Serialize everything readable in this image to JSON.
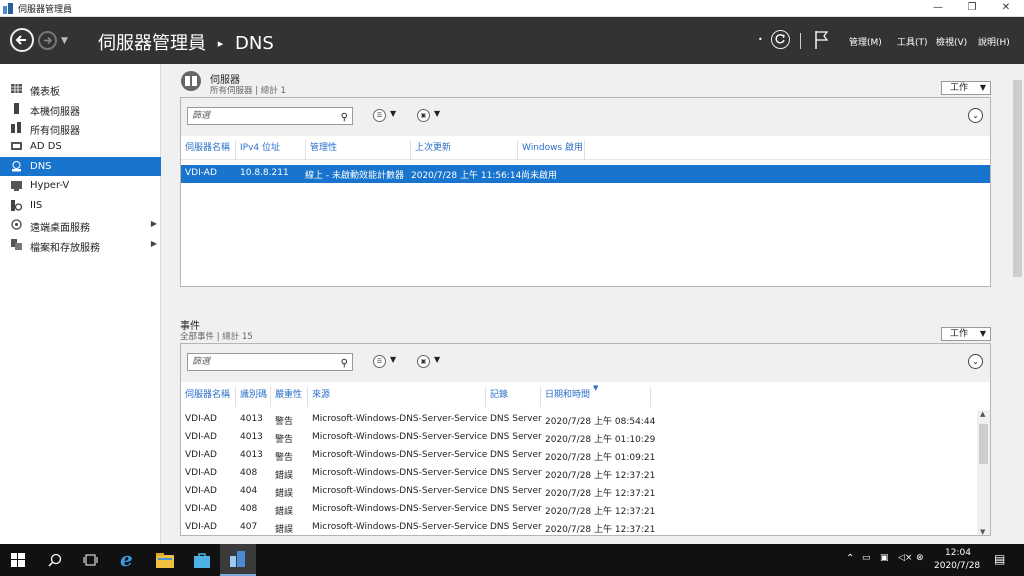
{
  "window": {
    "title": "伺服器管理員"
  },
  "header": {
    "crumb_root": "伺服器管理員",
    "crumb_current": "DNS",
    "menus": [
      "管理(M)",
      "工具(T)",
      "檢視(V)",
      "說明(H)"
    ]
  },
  "sidebar": {
    "items": [
      {
        "label": "儀表板"
      },
      {
        "label": "本機伺服器"
      },
      {
        "label": "所有伺服器"
      },
      {
        "label": "AD DS"
      },
      {
        "label": "DNS"
      },
      {
        "label": "Hyper-V"
      },
      {
        "label": "IIS"
      },
      {
        "label": "遠端桌面服務"
      },
      {
        "label": "檔案和存放服務"
      }
    ]
  },
  "servers": {
    "title": "伺服器",
    "subtitle": "所有伺服器 | 總計 1",
    "tasks_label": "工作",
    "filter_placeholder": "篩選",
    "columns": [
      "伺服器名稱",
      "IPv4 位址",
      "管理性",
      "上次更新",
      "Windows 啟用"
    ],
    "rows": [
      {
        "name": "VDI-AD",
        "ipv4": "10.8.8.211",
        "manageability": "線上 - 未啟動效能計數器",
        "last_update": "2020/7/28 上午 11:56:14",
        "activation": "尚未啟用"
      }
    ]
  },
  "events": {
    "title": "事件",
    "subtitle": "全部事件 | 總計 15",
    "tasks_label": "工作",
    "filter_placeholder": "篩選",
    "columns": [
      "伺服器名稱",
      "識別碼",
      "嚴重性",
      "來源",
      "記錄",
      "日期和時間"
    ],
    "rows": [
      {
        "server": "VDI-AD",
        "id": "4013",
        "severity": "警告",
        "source": "Microsoft-Windows-DNS-Server-Service",
        "log": "DNS Server",
        "datetime": "2020/7/28 上午 08:54:44"
      },
      {
        "server": "VDI-AD",
        "id": "4013",
        "severity": "警告",
        "source": "Microsoft-Windows-DNS-Server-Service",
        "log": "DNS Server",
        "datetime": "2020/7/28 上午 01:10:29"
      },
      {
        "server": "VDI-AD",
        "id": "4013",
        "severity": "警告",
        "source": "Microsoft-Windows-DNS-Server-Service",
        "log": "DNS Server",
        "datetime": "2020/7/28 上午 01:09:21"
      },
      {
        "server": "VDI-AD",
        "id": "408",
        "severity": "錯誤",
        "source": "Microsoft-Windows-DNS-Server-Service",
        "log": "DNS Server",
        "datetime": "2020/7/28 上午 12:37:21"
      },
      {
        "server": "VDI-AD",
        "id": "404",
        "severity": "錯誤",
        "source": "Microsoft-Windows-DNS-Server-Service",
        "log": "DNS Server",
        "datetime": "2020/7/28 上午 12:37:21"
      },
      {
        "server": "VDI-AD",
        "id": "408",
        "severity": "錯誤",
        "source": "Microsoft-Windows-DNS-Server-Service",
        "log": "DNS Server",
        "datetime": "2020/7/28 上午 12:37:21"
      },
      {
        "server": "VDI-AD",
        "id": "407",
        "severity": "錯誤",
        "source": "Microsoft-Windows-DNS-Server-Service",
        "log": "DNS Server",
        "datetime": "2020/7/28 上午 12:37:21"
      }
    ]
  },
  "taskbar": {
    "time": "12:04",
    "date": "2020/7/28"
  },
  "colors": {
    "header_bg": "#333333",
    "selection": "#1874cd",
    "column_header": "#2a6fc9"
  }
}
